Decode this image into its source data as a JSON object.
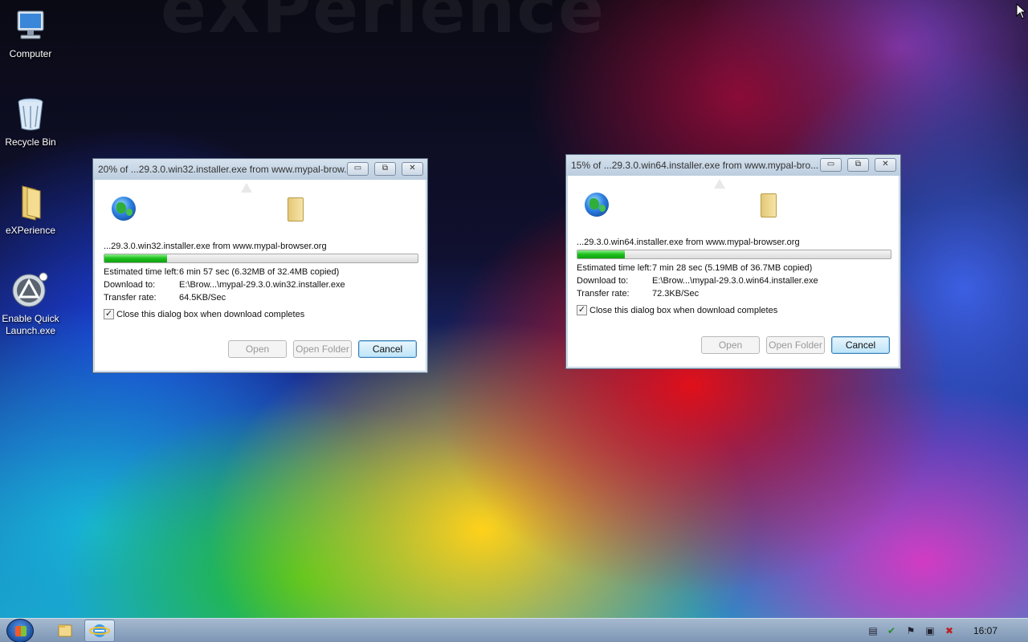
{
  "desktop": {
    "icons": [
      {
        "label": "Computer",
        "icon": "computer-icon"
      },
      {
        "label": "Recycle Bin",
        "icon": "recycle-bin-icon"
      },
      {
        "label": "eXPerience",
        "icon": "folder-icon"
      },
      {
        "label": "Enable Quick Launch.exe",
        "icon": "quick-launch-icon"
      }
    ]
  },
  "windows": [
    {
      "title": "20% of ...29.3.0.win32.installer.exe from www.mypal-brow...",
      "filename": "...29.3.0.win32.installer.exe from www.mypal-browser.org",
      "progress": 0.2,
      "estimated_label": "Estimated time left:",
      "estimated_value": "6 min 57 sec (6.32MB of 32.4MB copied)",
      "download_label": "Download to:",
      "download_value": "E:\\Brow...\\mypal-29.3.0.win32.installer.exe",
      "rate_label": "Transfer rate:",
      "rate_value": "64.5KB/Sec",
      "close_option": "Close this dialog box when download completes",
      "close_checked": true,
      "open_label": "Open",
      "open_folder_label": "Open Folder",
      "cancel_label": "Cancel"
    },
    {
      "title": "15% of ...29.3.0.win64.installer.exe from www.mypal-bro...",
      "filename": "...29.3.0.win64.installer.exe from www.mypal-browser.org",
      "progress": 0.15,
      "estimated_label": "Estimated time left:",
      "estimated_value": "7 min 28 sec (5.19MB of 36.7MB copied)",
      "download_label": "Download to:",
      "download_value": "E:\\Brow...\\mypal-29.3.0.win64.installer.exe",
      "rate_label": "Transfer rate:",
      "rate_value": "72.3KB/Sec",
      "close_option": "Close this dialog box when download completes",
      "close_checked": true,
      "open_label": "Open",
      "open_folder_label": "Open Folder",
      "cancel_label": "Cancel"
    }
  ],
  "taskbar": {
    "clock": "16:07"
  },
  "glyphs": {
    "minimize": "▭",
    "restore": "⧉",
    "close": "✕",
    "check": "✓"
  },
  "colors": {
    "progress_fill": "#1bbf1b",
    "cancel_border": "#3c7fb1"
  }
}
